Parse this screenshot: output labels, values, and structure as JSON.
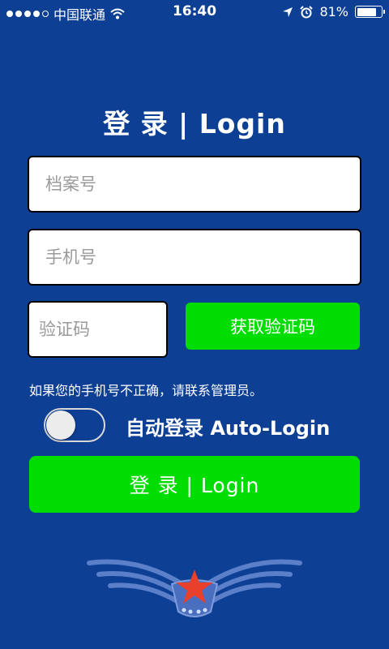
{
  "status_bar": {
    "carrier": "中国联通",
    "time": "16:40",
    "battery_text": "81%",
    "battery_level": 0.81
  },
  "title": "登 录 | Login",
  "form": {
    "archive_placeholder": "档案号",
    "phone_placeholder": "手机号",
    "code_placeholder": "验证码",
    "get_code_label": "获取验证码",
    "notice": "如果您的手机号不正确，请联系管理员。",
    "auto_login_label": "自动登录 Auto-Login",
    "auto_login_on": false,
    "login_label": "登 录 | Login"
  },
  "colors": {
    "background": "#0d3f94",
    "accent": "#00dd00",
    "star": "#e8402a"
  },
  "icons": [
    "wifi-icon",
    "location-arrow-icon",
    "alarm-icon",
    "battery-icon",
    "wings-logo"
  ]
}
